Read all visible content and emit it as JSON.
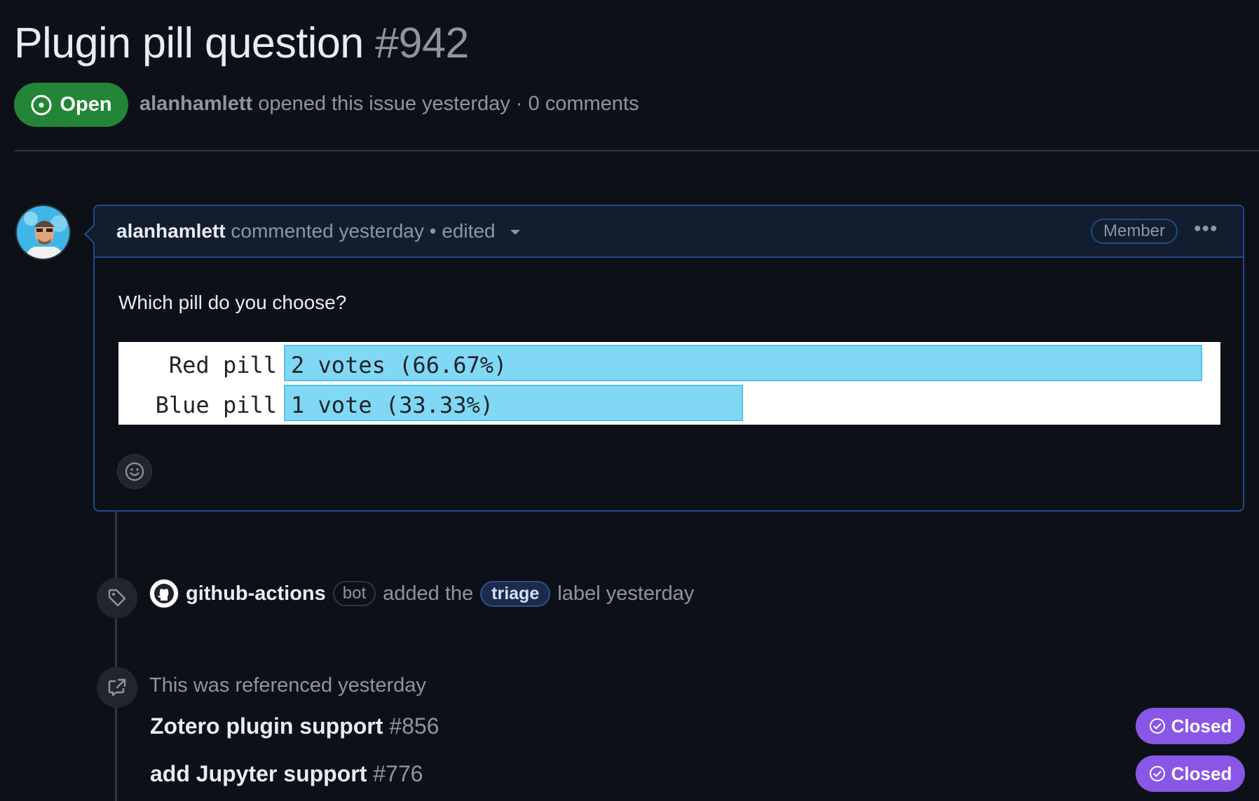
{
  "issue": {
    "title": "Plugin pill question",
    "number": "#942",
    "state": "Open",
    "author": "alanhamlett",
    "meta_text": "opened this issue yesterday · 0 comments"
  },
  "comment": {
    "author": "alanhamlett",
    "header_text": "commented yesterday • edited",
    "role_badge": "Member",
    "more_label": "•••",
    "body": "Which pill do you choose?",
    "poll": [
      {
        "label": "Red pill",
        "text": "2 votes (66.67%)",
        "votes": 2,
        "fraction": 0.6667
      },
      {
        "label": "Blue pill",
        "text": "1 vote (33.33%)",
        "votes": 1,
        "fraction": 0.3333
      }
    ]
  },
  "timeline": {
    "label_event": {
      "actor": "github-actions",
      "actor_badge": "bot",
      "text_before": "added the",
      "label": "triage",
      "text_after": "label yesterday"
    },
    "reference_event": {
      "text": "This was referenced yesterday",
      "items": [
        {
          "title": "Zotero plugin support",
          "number": "#856",
          "state": "Closed"
        },
        {
          "title": "add Jupyter support",
          "number": "#776",
          "state": "Closed"
        }
      ]
    }
  },
  "colors": {
    "open_green": "#238636",
    "closed_purple": "#8957e5",
    "poll_bar": "#80d8f5",
    "accent_border": "#1f4a87"
  },
  "icons": [
    "issue-open-icon",
    "caret-down-icon",
    "kebab-icon",
    "smiley-icon",
    "tag-icon",
    "cross-reference-icon",
    "github-logo-icon",
    "check-circle-icon"
  ]
}
